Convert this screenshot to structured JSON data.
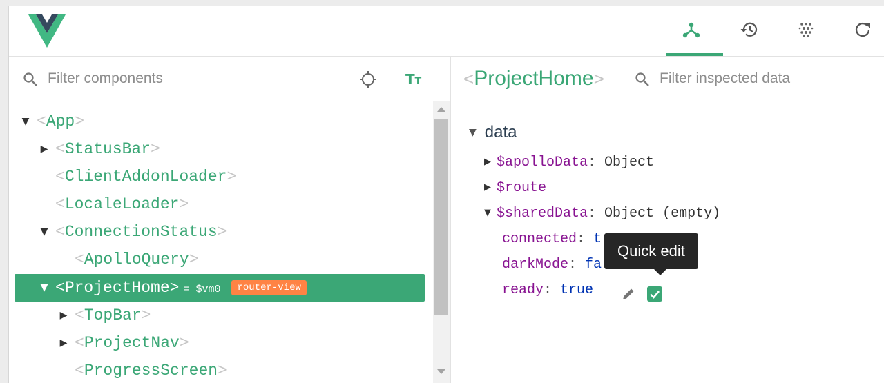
{
  "toolbar": {
    "logo_icon": "vue-logo-icon",
    "buttons": [
      {
        "icon": "components-icon",
        "active": true
      },
      {
        "icon": "history-icon"
      },
      {
        "icon": "dots-grid-icon"
      },
      {
        "icon": "refresh-icon"
      }
    ],
    "accent_color": "#3ba776"
  },
  "components_pane": {
    "filter": {
      "placeholder": "Filter components",
      "value": ""
    },
    "tree": [
      {
        "name": "App",
        "expanded": true,
        "depth": 0
      },
      {
        "name": "StatusBar",
        "expanded": false,
        "depth": 1
      },
      {
        "name": "ClientAddonLoader",
        "depth": 1
      },
      {
        "name": "LocaleLoader",
        "depth": 1
      },
      {
        "name": "ConnectionStatus",
        "expanded": true,
        "depth": 1
      },
      {
        "name": "ApolloQuery",
        "depth": 2
      },
      {
        "name": "ProjectHome",
        "expanded": true,
        "depth": 1,
        "selected": true,
        "vm": "= $vm0",
        "badge": "router-view"
      },
      {
        "name": "TopBar",
        "expanded": false,
        "depth": 2
      },
      {
        "name": "ProjectNav",
        "expanded": false,
        "depth": 2
      },
      {
        "name": "ProgressScreen",
        "depth": 2
      }
    ]
  },
  "inspector": {
    "component_name": "ProjectHome",
    "filter": {
      "placeholder": "Filter inspected data",
      "value": ""
    },
    "section": "data",
    "props": [
      {
        "key": "$apolloData",
        "value": "Object",
        "expandable": true,
        "expanded": false
      },
      {
        "key": "$route",
        "value": "",
        "expandable": true,
        "expanded": false
      },
      {
        "key": "$sharedData",
        "value": "Object (empty)",
        "expandable": true,
        "expanded": true
      },
      {
        "key": "connected",
        "value": "t"
      },
      {
        "key": "darkMode",
        "value": "fa"
      },
      {
        "key": "ready",
        "value": "true",
        "checked": true
      }
    ],
    "tooltip": "Quick edit"
  }
}
